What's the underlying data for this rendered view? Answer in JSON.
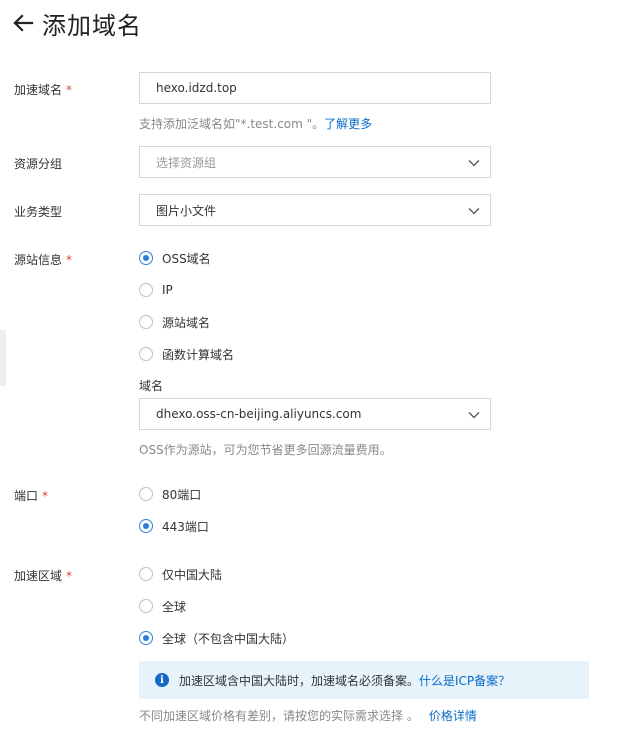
{
  "header": {
    "title": "添加域名",
    "back_icon": "arrow-left-icon"
  },
  "form": {
    "domain": {
      "label": "加速域名",
      "required_mark": "*",
      "value": "hexo.idzd.top",
      "help_prefix": "支持添加泛域名如\"*.test.com \"。",
      "help_link": "了解更多"
    },
    "resource_group": {
      "label": "资源分组",
      "placeholder": "选择资源组"
    },
    "business_type": {
      "label": "业务类型",
      "value": "图片小文件"
    },
    "origin": {
      "label": "源站信息",
      "required_mark": "*",
      "options": [
        "OSS域名",
        "IP",
        "源站域名",
        "函数计算域名"
      ],
      "selected": "OSS域名",
      "domain_sublabel": "域名",
      "domain_value": "dhexo.oss-cn-beijing.aliyuncs.com",
      "help": "OSS作为源站，可为您节省更多回源流量费用。"
    },
    "port": {
      "label": "端口",
      "required_mark": "*",
      "options": [
        "80端口",
        "443端口"
      ],
      "selected": "443端口"
    },
    "region": {
      "label": "加速区域",
      "required_mark": "*",
      "options": [
        "仅中国大陆",
        "全球",
        "全球（不包含中国大陆）"
      ],
      "selected": "全球（不包含中国大陆）",
      "notice_text": "加速区域含中国大陆时，加速域名必须备案。",
      "notice_link": "什么是ICP备案？",
      "price_text": "不同加速区域价格有差别，请按您的实际需求选择 。",
      "price_link": "价格详情"
    }
  },
  "colors": {
    "accent": "#2e7ce0",
    "link": "#0a6cc9",
    "required": "#e0463a",
    "notice_bg": "#e6f3fb"
  }
}
